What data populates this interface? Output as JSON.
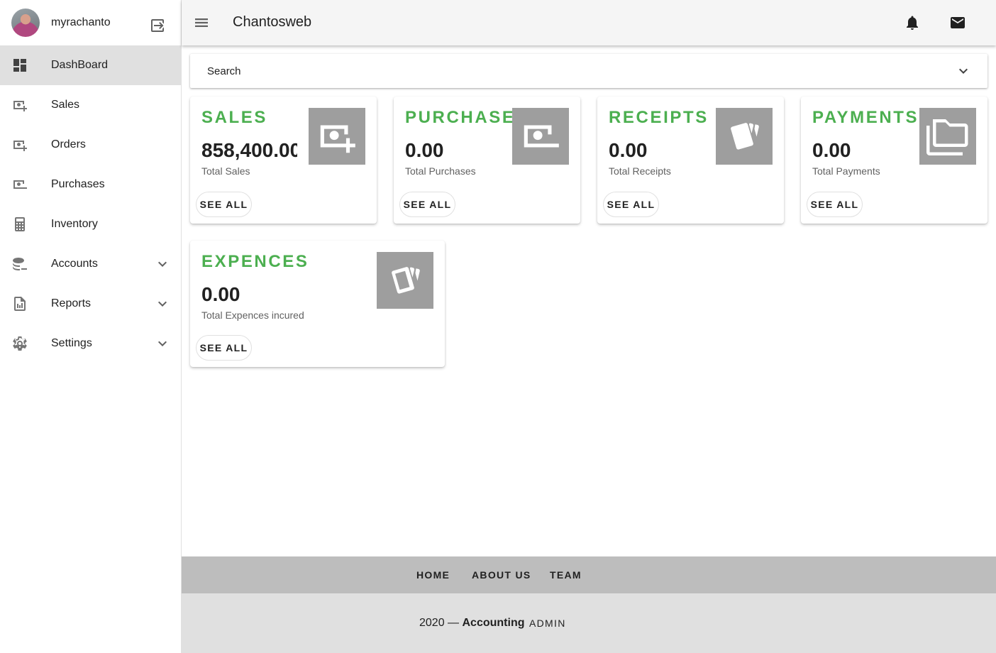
{
  "app": {
    "title": "Chantosweb"
  },
  "profile": {
    "name": "myrachanto"
  },
  "sidebar": {
    "items": [
      {
        "label": "DashBoard",
        "icon": "dashboard-icon",
        "active": true
      },
      {
        "label": "Sales",
        "icon": "cash-plus-icon"
      },
      {
        "label": "Orders",
        "icon": "cash-plus-icon"
      },
      {
        "label": "Purchases",
        "icon": "cash-minus-icon"
      },
      {
        "label": "Inventory",
        "icon": "calculator-icon"
      },
      {
        "label": "Accounts",
        "icon": "database-minus-icon",
        "expandable": true
      },
      {
        "label": "Reports",
        "icon": "file-chart-icon",
        "expandable": true
      },
      {
        "label": "Settings",
        "icon": "gear-icon",
        "expandable": true
      }
    ]
  },
  "search": {
    "label": "Search"
  },
  "cards": [
    {
      "title": "SALES",
      "value": "858,400.00",
      "subtitle": "Total Sales",
      "button": "SEE ALL",
      "icon": "cash-plus-icon"
    },
    {
      "title": "PURCHASE",
      "value": "0.00",
      "subtitle": "Total Purchases",
      "button": "SEE ALL",
      "icon": "cash-minus-icon"
    },
    {
      "title": "RECEIPTS",
      "value": "0.00",
      "subtitle": "Total Receipts",
      "button": "SEE ALL",
      "icon": "cards-icon"
    },
    {
      "title": "PAYMENTS",
      "value": "0.00",
      "subtitle": "Total Payments",
      "button": "SEE ALL",
      "icon": "folders-icon"
    },
    {
      "title": "EXPENCES",
      "value": "0.00",
      "subtitle": "Total Expences incured",
      "button": "SEE ALL",
      "icon": "cards-icon"
    }
  ],
  "footer": {
    "links": [
      "HOME",
      "ABOUT US",
      "TEAM"
    ],
    "year": "2020 —",
    "brand": "Accounting",
    "admin": "ADMIN"
  },
  "colors": {
    "accent": "#4caf50",
    "icon_bg": "#9e9e9e",
    "topbar": "#f5f5f5",
    "footer_top": "#bdbdbd",
    "footer_bottom": "#e0e0e0",
    "active_nav": "#e0e0e0"
  }
}
